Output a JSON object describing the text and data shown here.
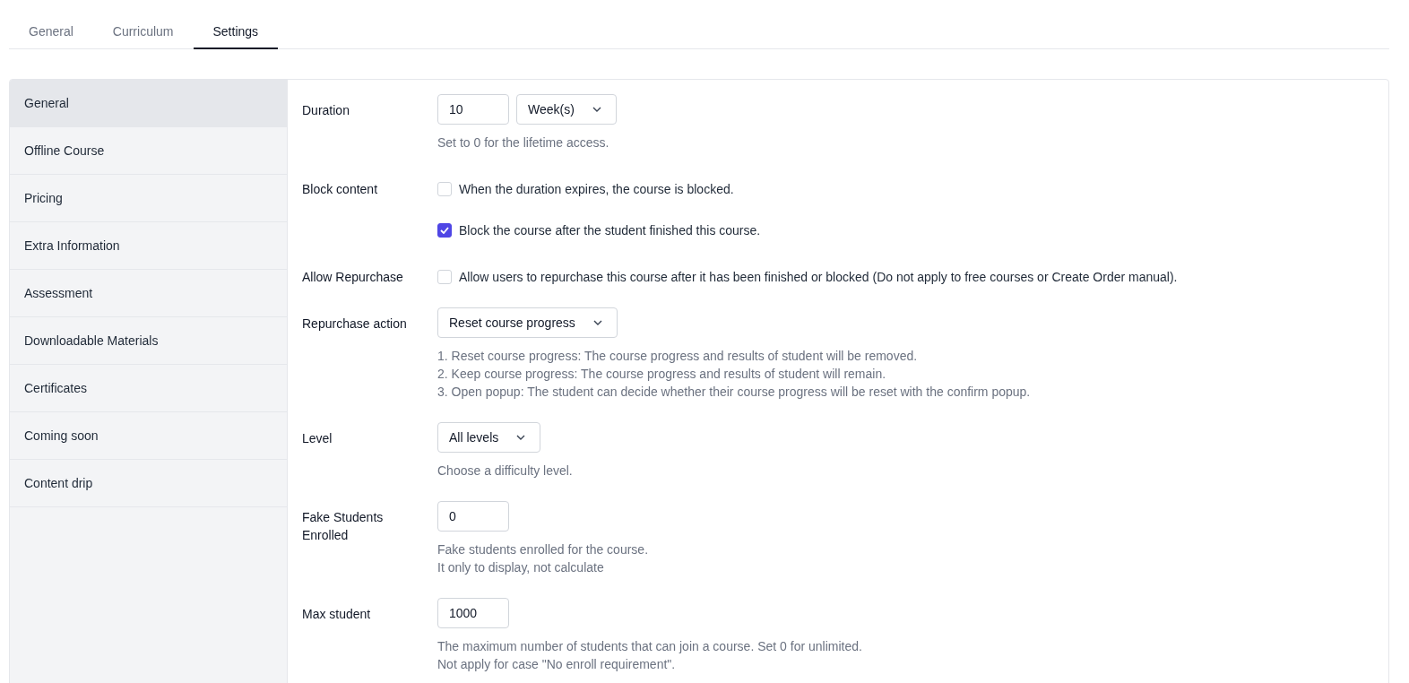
{
  "tabs": [
    {
      "label": "General",
      "selected": false
    },
    {
      "label": "Curriculum",
      "selected": false
    },
    {
      "label": "Settings",
      "selected": true
    }
  ],
  "sidebar": {
    "items": [
      {
        "label": "General",
        "selected": true
      },
      {
        "label": "Offline Course",
        "selected": false
      },
      {
        "label": "Pricing",
        "selected": false
      },
      {
        "label": "Extra Information",
        "selected": false
      },
      {
        "label": "Assessment",
        "selected": false
      },
      {
        "label": "Downloadable Materials",
        "selected": false
      },
      {
        "label": "Certificates",
        "selected": false
      },
      {
        "label": "Coming soon",
        "selected": false
      },
      {
        "label": "Content drip",
        "selected": false
      }
    ]
  },
  "fields": [
    {
      "label": "Duration",
      "controls": [
        {
          "kind": "input",
          "value": "10"
        },
        {
          "kind": "select",
          "value": "Week(s)"
        }
      ],
      "help": [
        "Set to 0 for the lifetime access."
      ]
    },
    {
      "label": "Block content",
      "controls": [
        {
          "kind": "checkbox",
          "text": "When the duration expires, the course is blocked.",
          "checked": false
        },
        {
          "kind": "checkbox",
          "text": "Block the course after the student finished this course.",
          "checked": true
        }
      ]
    },
    {
      "label": "Allow Repurchase",
      "controls": [
        {
          "kind": "checkbox",
          "text": "Allow users to repurchase this course after it has been finished or blocked (Do not apply to free courses or Create Order manual).",
          "checked": false
        }
      ]
    },
    {
      "label": "Repurchase action",
      "controls": [
        {
          "kind": "select",
          "value": "Reset course progress"
        }
      ],
      "help": [
        "1. Reset course progress: The course progress and results of student will be removed.",
        "2. Keep course progress: The course progress and results of student will remain.",
        "3. Open popup: The student can decide whether their course progress will be reset with the confirm popup."
      ]
    },
    {
      "label": "Level",
      "controls": [
        {
          "kind": "select",
          "value": "All levels"
        }
      ],
      "help": [
        "Choose a difficulty level."
      ]
    },
    {
      "label": "Fake Students Enrolled",
      "controls": [
        {
          "kind": "input",
          "value": "0"
        }
      ],
      "help": [
        "Fake students enrolled for the course.",
        "It only to display, not calculate"
      ]
    },
    {
      "label": "Max student",
      "controls": [
        {
          "kind": "input",
          "value": "1000"
        }
      ],
      "help": [
        "The maximum number of students that can join a course. Set 0 for unlimited.",
        "Not apply for case \"No enroll requirement\"."
      ]
    }
  ]
}
